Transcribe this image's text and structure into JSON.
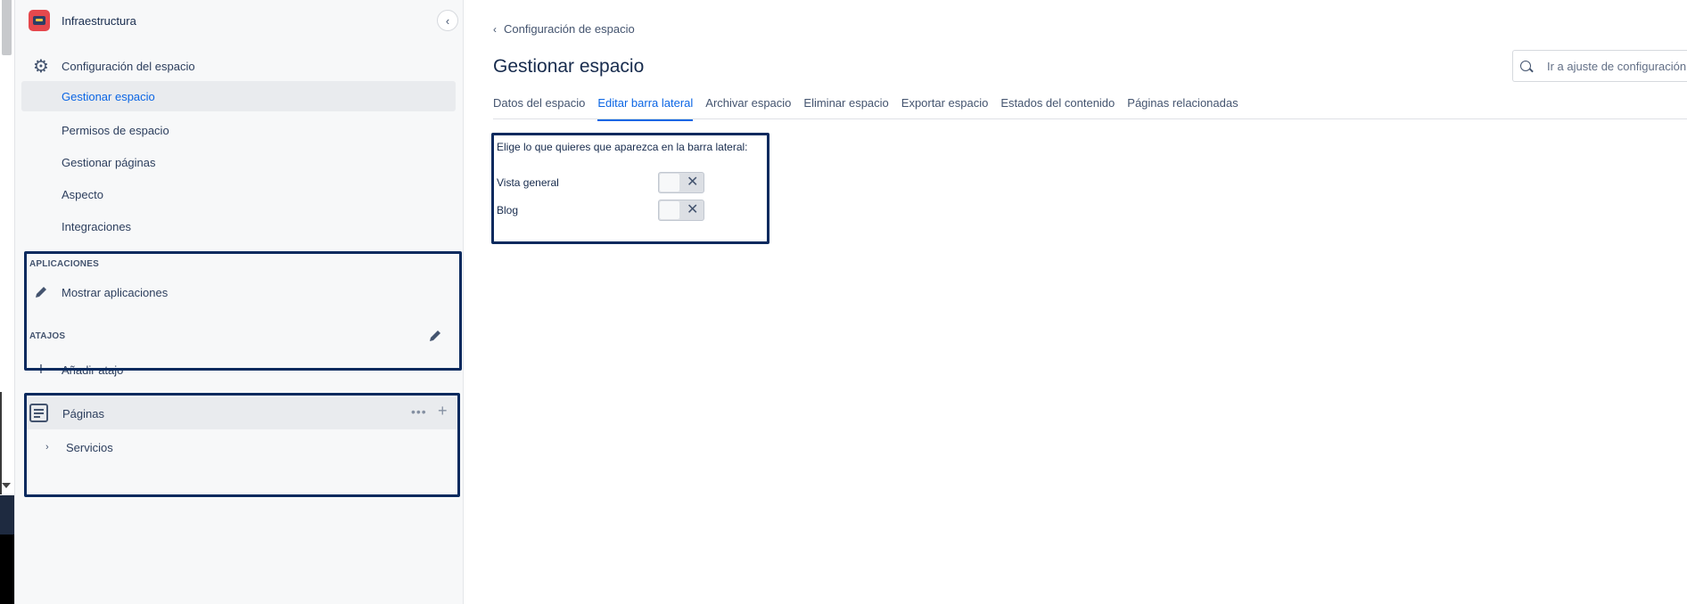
{
  "sidebar": {
    "space_name": "Infraestructura",
    "collapse_icon": "chevron-left-icon",
    "settings_label": "Configuración del espacio",
    "items": [
      {
        "label": "Gestionar espacio",
        "active": true
      },
      {
        "label": "Permisos de espacio",
        "active": false
      },
      {
        "label": "Gestionar páginas",
        "active": false
      },
      {
        "label": "Aspecto",
        "active": false
      },
      {
        "label": "Integraciones",
        "active": false
      }
    ],
    "apps_title": "APLICACIONES",
    "apps_show": "Mostrar aplicaciones",
    "shortcuts_title": "ATAJOS",
    "add_shortcut": "Añadir atajo",
    "pages_label": "Páginas",
    "pages_more": "•••",
    "pages_add": "+",
    "tree_item": "Servicios"
  },
  "main": {
    "breadcrumb": "Configuración de espacio",
    "title": "Gestionar espacio",
    "search_placeholder": "Ir a ajuste de configuración...",
    "tabs": [
      {
        "label": "Datos del espacio",
        "active": false
      },
      {
        "label": "Editar barra lateral",
        "active": true
      },
      {
        "label": "Archivar espacio",
        "active": false
      },
      {
        "label": "Eliminar espacio",
        "active": false
      },
      {
        "label": "Exportar espacio",
        "active": false
      },
      {
        "label": "Estados del contenido",
        "active": false
      },
      {
        "label": "Páginas relacionadas",
        "active": false
      }
    ],
    "panel_intro": "Elige lo que quieres que aparezca en la barra lateral:",
    "options": [
      {
        "label": "Vista general",
        "enabled": false
      },
      {
        "label": "Blog",
        "enabled": false
      }
    ]
  },
  "colors": {
    "accent": "#0c66e4",
    "highlight_border": "#0a2a5e",
    "sidebar_bg": "#f7f8f9"
  }
}
